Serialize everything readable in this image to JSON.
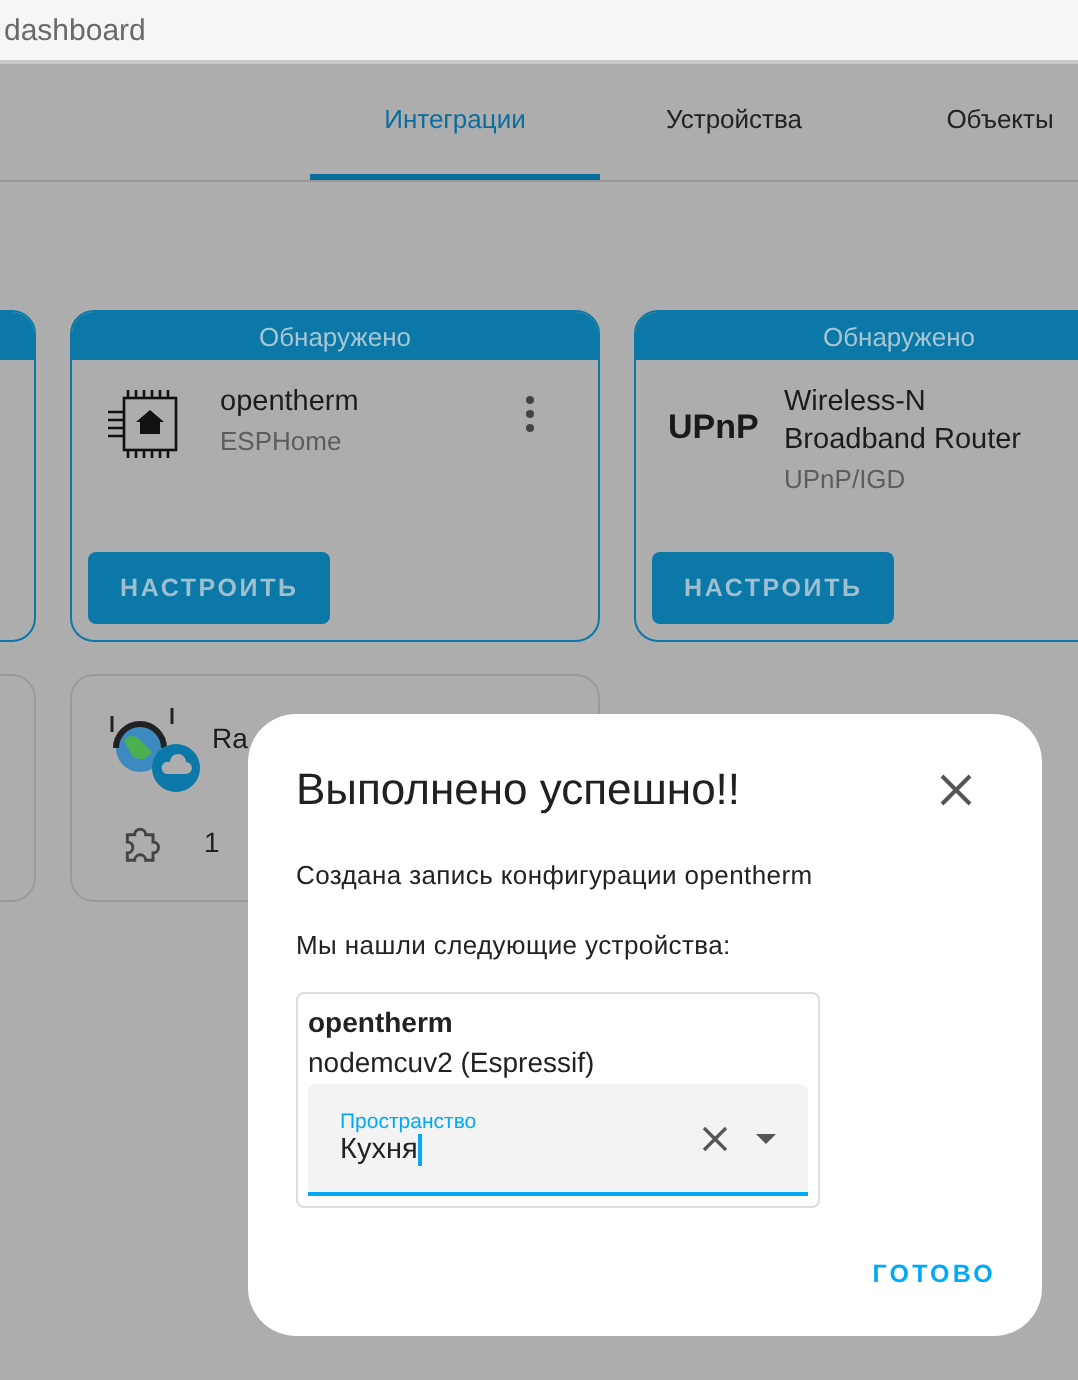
{
  "address_bar": {
    "url": "dashboard"
  },
  "tabs": [
    {
      "label": "Интеграции",
      "selected": true
    },
    {
      "label": "Устройства",
      "selected": false
    },
    {
      "label": "Объекты",
      "selected": false
    }
  ],
  "card_rows": [
    {
      "cards": [
        {
          "kind": "edge",
          "header": true
        },
        {
          "kind": "discovered",
          "header_text": "Обнаружено",
          "name": "opentherm",
          "domain": "ESPHome",
          "menu": true,
          "button": "НАСТРОИТЬ"
        },
        {
          "kind": "discovered",
          "header_text": "Обнаружено",
          "logo_text": "UPnP",
          "name": "Wireless-N Broadband Router",
          "domain": "UPnP/IGD",
          "button": "НАСТРОИТЬ"
        }
      ]
    },
    {
      "cards": [
        {
          "kind": "edge",
          "header": false
        },
        {
          "kind": "configured",
          "cloud": true,
          "name": "Ra",
          "count": "1"
        }
      ]
    }
  ],
  "dialog": {
    "title": "Выполнено успешно!!",
    "message": "Создана запись конфигурации opentherm",
    "found_label": "Мы нашли следующие устройства:",
    "devices": [
      {
        "name": "opentherm",
        "model": "nodemcuv2 (Espressif)",
        "area_field": {
          "label": "Пространство",
          "value": "Кухня",
          "focused": true
        }
      }
    ],
    "button": "ГОТОВО"
  }
}
